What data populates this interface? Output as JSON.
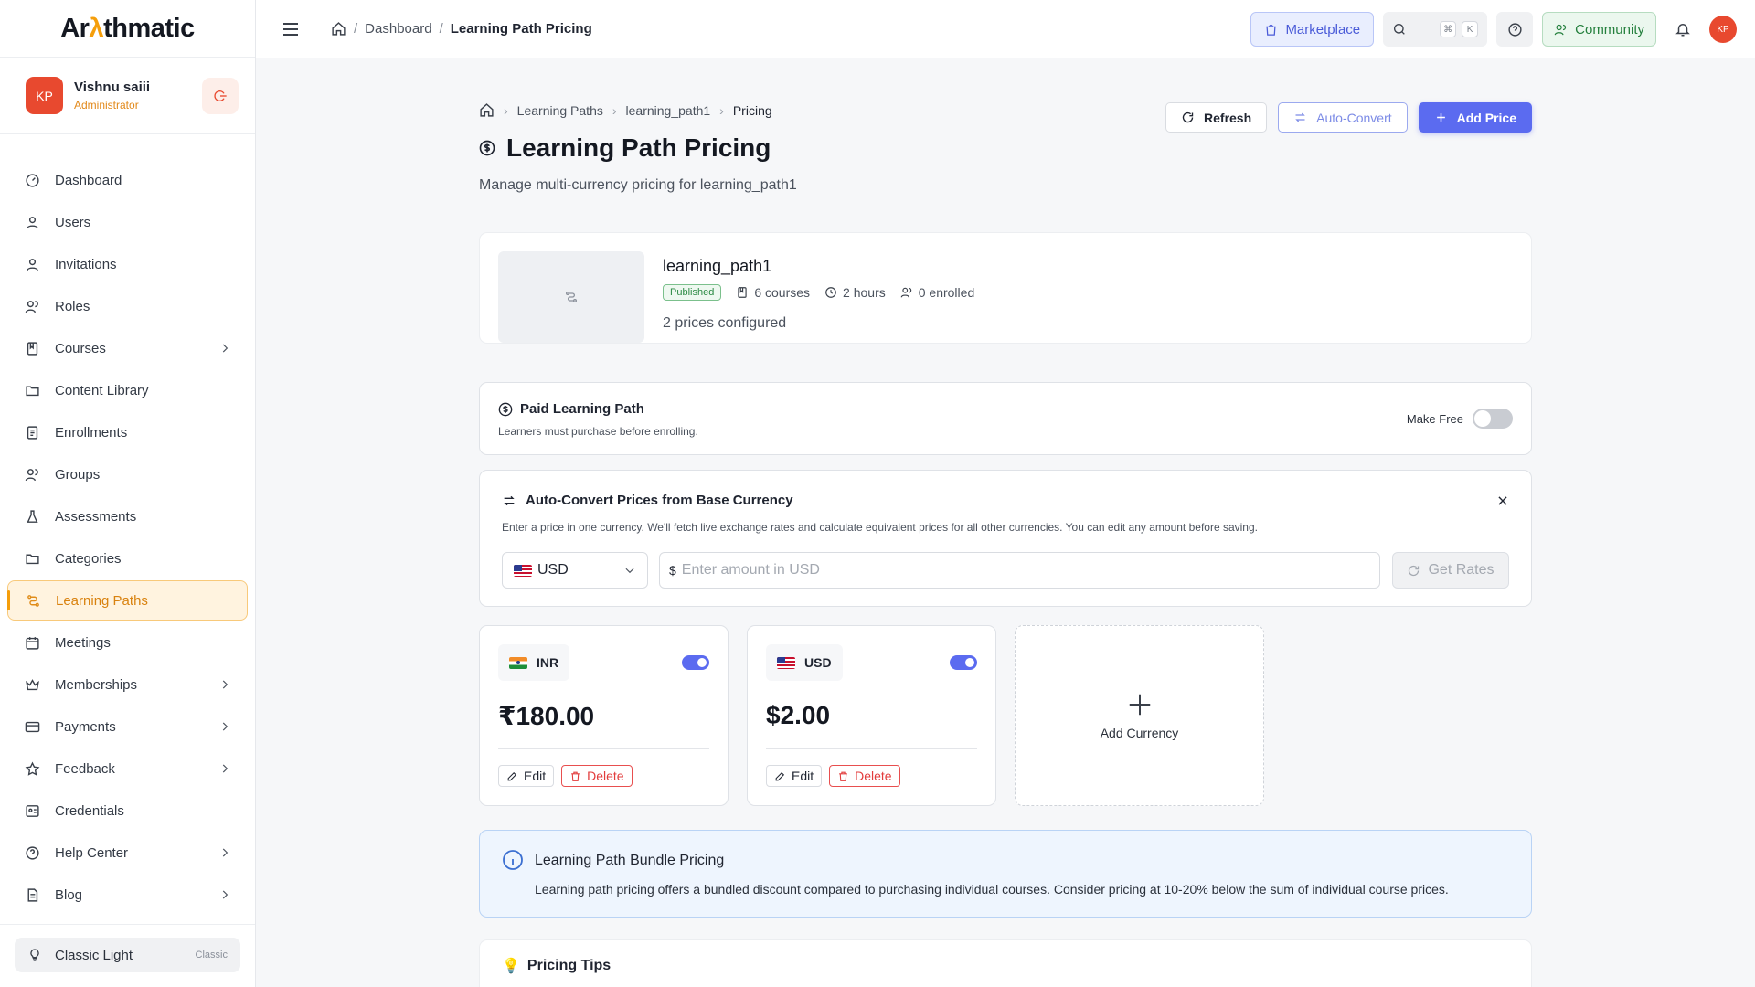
{
  "app": {
    "logo_pre": "Ar",
    "logo_accent": "λ",
    "logo_post": "thmatic"
  },
  "user": {
    "initials": "KP",
    "name": "Vishnu saiii",
    "role": "Administrator"
  },
  "sidebar": {
    "items": [
      {
        "label": "Dashboard",
        "icon": "dashboard-icon",
        "chevron": false
      },
      {
        "label": "Users",
        "icon": "user-icon",
        "chevron": false
      },
      {
        "label": "Invitations",
        "icon": "user-plus-icon",
        "chevron": false
      },
      {
        "label": "Roles",
        "icon": "roles-icon",
        "chevron": false
      },
      {
        "label": "Courses",
        "icon": "book-icon",
        "chevron": true
      },
      {
        "label": "Content Library",
        "icon": "folder-icon",
        "chevron": false
      },
      {
        "label": "Enrollments",
        "icon": "clipboard-icon",
        "chevron": false
      },
      {
        "label": "Groups",
        "icon": "group-icon",
        "chevron": false
      },
      {
        "label": "Assessments",
        "icon": "flask-icon",
        "chevron": false
      },
      {
        "label": "Categories",
        "icon": "folder-icon",
        "chevron": false
      },
      {
        "label": "Learning Paths",
        "icon": "path-icon",
        "chevron": false,
        "active": true
      },
      {
        "label": "Meetings",
        "icon": "calendar-icon",
        "chevron": false
      },
      {
        "label": "Memberships",
        "icon": "crown-icon",
        "chevron": true
      },
      {
        "label": "Payments",
        "icon": "credit-card-icon",
        "chevron": true
      },
      {
        "label": "Feedback",
        "icon": "star-icon",
        "chevron": true
      },
      {
        "label": "Credentials",
        "icon": "id-card-icon",
        "chevron": false
      },
      {
        "label": "Help Center",
        "icon": "help-circle-icon",
        "chevron": true
      },
      {
        "label": "Blog",
        "icon": "file-text-icon",
        "chevron": true
      }
    ],
    "theme_label": "Classic Light",
    "theme_tag": "Classic"
  },
  "topbar": {
    "crumbs": [
      "Dashboard",
      "Learning Path Pricing"
    ],
    "marketplace": "Marketplace",
    "kbd1": "⌘",
    "kbd2": "K",
    "community": "Community",
    "avatar": "KP"
  },
  "page": {
    "crumbs": [
      "Learning Paths",
      "learning_path1",
      "Pricing"
    ],
    "title": "Learning Path Pricing",
    "subtitle": "Manage multi-currency pricing for learning_path1",
    "refresh": "Refresh",
    "auto_convert": "Auto-Convert",
    "add_price": "Add Price"
  },
  "learning_path": {
    "name": "learning_path1",
    "status": "Published",
    "courses": "6 courses",
    "duration": "2 hours",
    "enrolled": "0 enrolled",
    "prices_configured": "2 prices configured"
  },
  "paid": {
    "title": "Paid Learning Path",
    "subtitle": "Learners must purchase before enrolling.",
    "make_free_label": "Make Free",
    "make_free_on": false
  },
  "auto_convert": {
    "title": "Auto-Convert Prices from Base Currency",
    "description": "Enter a price in one currency. We'll fetch live exchange rates and calculate equivalent prices for all other currencies. You can edit any amount before saving.",
    "currency": "USD",
    "amount_prefix": "$",
    "amount_value": "",
    "amount_placeholder": "Enter amount in USD",
    "get_rates": "Get Rates"
  },
  "prices": [
    {
      "currency": "INR",
      "amount": "₹180.00",
      "enabled": true,
      "edit": "Edit",
      "delete": "Delete"
    },
    {
      "currency": "USD",
      "amount": "$2.00",
      "enabled": true,
      "edit": "Edit",
      "delete": "Delete"
    }
  ],
  "add_currency": "Add Currency",
  "bundle": {
    "title": "Learning Path Bundle Pricing",
    "text": "Learning path pricing offers a bundled discount compared to purchasing individual courses. Consider pricing at 10-20% below the sum of individual course prices."
  },
  "tips": {
    "icon": "💡",
    "title": "Pricing Tips"
  },
  "colors": {
    "accent": "#5b6bf0",
    "brand_orange": "#f59e0b",
    "danger": "#e23c3c",
    "success": "#2c8a44"
  }
}
